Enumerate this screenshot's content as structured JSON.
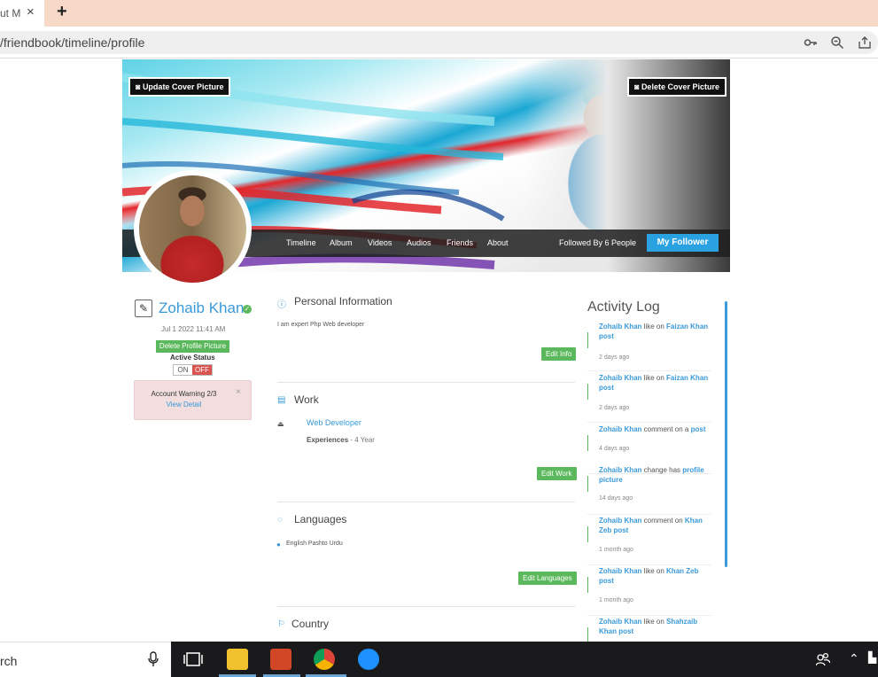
{
  "browser": {
    "tab_title": "ut M",
    "tab_close": "×",
    "new_tab": "+",
    "url": "/friendbook/timeline/profile",
    "icons": [
      "key-icon",
      "zoom-icon",
      "share-icon"
    ]
  },
  "cover": {
    "update_btn": "Update Cover Picture",
    "delete_btn": "Delete Cover Picture",
    "nav": [
      "Timeline",
      "Album",
      "Videos",
      "Audios",
      "Friends",
      "About"
    ],
    "followed_by": "Followed By 6 People",
    "my_follower_btn": "My Follower"
  },
  "profile": {
    "name": "Zohaib Khan",
    "joined": "Jul 1 2022 11:41 AM",
    "delete_picture_btn": "Delete Profile Picture",
    "active_status_label": "Active Status",
    "toggle_on": "ON",
    "toggle_off": "OFF",
    "warning_text": "Account Warning 2/3",
    "warning_link": "View Detail",
    "warning_close": "×"
  },
  "sections": {
    "personal": {
      "title": "Personal Information",
      "text": "I am expert Php Web developer",
      "edit_btn": "Edit Info"
    },
    "work": {
      "title": "Work",
      "job": "Web Developer",
      "experience_label": "Experiences",
      "experience_value": " - 4 Year",
      "edit_btn": "Edit Work"
    },
    "languages": {
      "title": "Languages",
      "list": "English Pashto Urdu",
      "edit_btn": "Edit Languages"
    },
    "country": {
      "title": "Country"
    }
  },
  "activity": {
    "title": "Activity Log",
    "items": [
      {
        "user": "Zohaib Khan",
        "action": " like on ",
        "target": "Faizan Khan post",
        "time": "2 days ago"
      },
      {
        "user": "Zohaib Khan",
        "action": " like on ",
        "target": "Faizan Khan post",
        "time": "2 days ago"
      },
      {
        "user": "Zohaib Khan",
        "action": " comment on a ",
        "target": "post",
        "time": "4 days ago"
      },
      {
        "user": "Zohaib Khan",
        "action": " change has ",
        "target": "profile picture",
        "time": "14 days ago"
      },
      {
        "user": "Zohaib Khan",
        "action": " comment on ",
        "target": "Khan Zeb post",
        "time": "1 month ago"
      },
      {
        "user": "Zohaib Khan",
        "action": " like on ",
        "target": "Khan Zeb post",
        "time": "1 month ago"
      },
      {
        "user": "Zohaib Khan",
        "action": " like on ",
        "target": "Shahzaib Khan post",
        "time": ""
      }
    ]
  },
  "taskbar": {
    "search_text": "rch",
    "colors": {
      "explorer": "#f2c12e",
      "powerpoint": "#d24726",
      "chrome": "#4caf50",
      "edge": "#1e90ff"
    }
  }
}
